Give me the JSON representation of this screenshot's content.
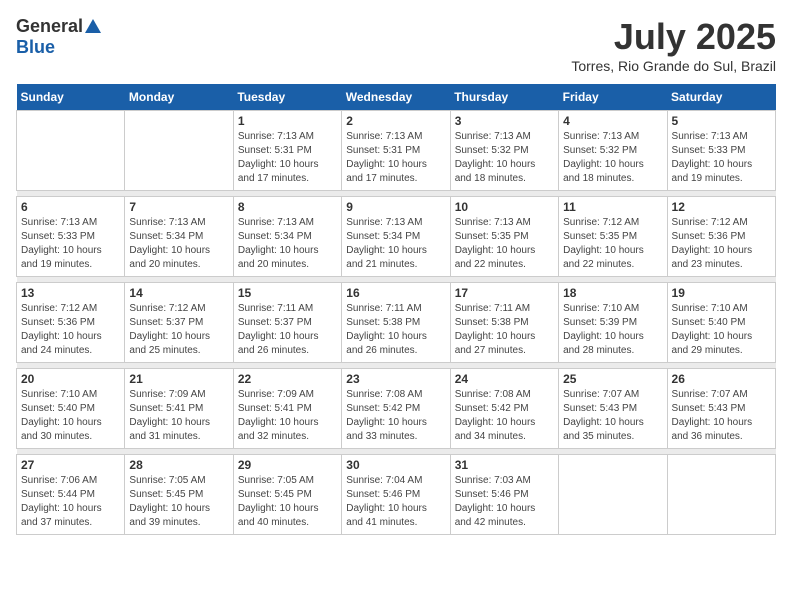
{
  "header": {
    "logo_general": "General",
    "logo_blue": "Blue",
    "month_title": "July 2025",
    "location": "Torres, Rio Grande do Sul, Brazil"
  },
  "calendar": {
    "days_of_week": [
      "Sunday",
      "Monday",
      "Tuesday",
      "Wednesday",
      "Thursday",
      "Friday",
      "Saturday"
    ],
    "weeks": [
      [
        {
          "day": "",
          "info": ""
        },
        {
          "day": "",
          "info": ""
        },
        {
          "day": "1",
          "info": "Sunrise: 7:13 AM\nSunset: 5:31 PM\nDaylight: 10 hours and 17 minutes."
        },
        {
          "day": "2",
          "info": "Sunrise: 7:13 AM\nSunset: 5:31 PM\nDaylight: 10 hours and 17 minutes."
        },
        {
          "day": "3",
          "info": "Sunrise: 7:13 AM\nSunset: 5:32 PM\nDaylight: 10 hours and 18 minutes."
        },
        {
          "day": "4",
          "info": "Sunrise: 7:13 AM\nSunset: 5:32 PM\nDaylight: 10 hours and 18 minutes."
        },
        {
          "day": "5",
          "info": "Sunrise: 7:13 AM\nSunset: 5:33 PM\nDaylight: 10 hours and 19 minutes."
        }
      ],
      [
        {
          "day": "6",
          "info": "Sunrise: 7:13 AM\nSunset: 5:33 PM\nDaylight: 10 hours and 19 minutes."
        },
        {
          "day": "7",
          "info": "Sunrise: 7:13 AM\nSunset: 5:34 PM\nDaylight: 10 hours and 20 minutes."
        },
        {
          "day": "8",
          "info": "Sunrise: 7:13 AM\nSunset: 5:34 PM\nDaylight: 10 hours and 20 minutes."
        },
        {
          "day": "9",
          "info": "Sunrise: 7:13 AM\nSunset: 5:34 PM\nDaylight: 10 hours and 21 minutes."
        },
        {
          "day": "10",
          "info": "Sunrise: 7:13 AM\nSunset: 5:35 PM\nDaylight: 10 hours and 22 minutes."
        },
        {
          "day": "11",
          "info": "Sunrise: 7:12 AM\nSunset: 5:35 PM\nDaylight: 10 hours and 22 minutes."
        },
        {
          "day": "12",
          "info": "Sunrise: 7:12 AM\nSunset: 5:36 PM\nDaylight: 10 hours and 23 minutes."
        }
      ],
      [
        {
          "day": "13",
          "info": "Sunrise: 7:12 AM\nSunset: 5:36 PM\nDaylight: 10 hours and 24 minutes."
        },
        {
          "day": "14",
          "info": "Sunrise: 7:12 AM\nSunset: 5:37 PM\nDaylight: 10 hours and 25 minutes."
        },
        {
          "day": "15",
          "info": "Sunrise: 7:11 AM\nSunset: 5:37 PM\nDaylight: 10 hours and 26 minutes."
        },
        {
          "day": "16",
          "info": "Sunrise: 7:11 AM\nSunset: 5:38 PM\nDaylight: 10 hours and 26 minutes."
        },
        {
          "day": "17",
          "info": "Sunrise: 7:11 AM\nSunset: 5:38 PM\nDaylight: 10 hours and 27 minutes."
        },
        {
          "day": "18",
          "info": "Sunrise: 7:10 AM\nSunset: 5:39 PM\nDaylight: 10 hours and 28 minutes."
        },
        {
          "day": "19",
          "info": "Sunrise: 7:10 AM\nSunset: 5:40 PM\nDaylight: 10 hours and 29 minutes."
        }
      ],
      [
        {
          "day": "20",
          "info": "Sunrise: 7:10 AM\nSunset: 5:40 PM\nDaylight: 10 hours and 30 minutes."
        },
        {
          "day": "21",
          "info": "Sunrise: 7:09 AM\nSunset: 5:41 PM\nDaylight: 10 hours and 31 minutes."
        },
        {
          "day": "22",
          "info": "Sunrise: 7:09 AM\nSunset: 5:41 PM\nDaylight: 10 hours and 32 minutes."
        },
        {
          "day": "23",
          "info": "Sunrise: 7:08 AM\nSunset: 5:42 PM\nDaylight: 10 hours and 33 minutes."
        },
        {
          "day": "24",
          "info": "Sunrise: 7:08 AM\nSunset: 5:42 PM\nDaylight: 10 hours and 34 minutes."
        },
        {
          "day": "25",
          "info": "Sunrise: 7:07 AM\nSunset: 5:43 PM\nDaylight: 10 hours and 35 minutes."
        },
        {
          "day": "26",
          "info": "Sunrise: 7:07 AM\nSunset: 5:43 PM\nDaylight: 10 hours and 36 minutes."
        }
      ],
      [
        {
          "day": "27",
          "info": "Sunrise: 7:06 AM\nSunset: 5:44 PM\nDaylight: 10 hours and 37 minutes."
        },
        {
          "day": "28",
          "info": "Sunrise: 7:05 AM\nSunset: 5:45 PM\nDaylight: 10 hours and 39 minutes."
        },
        {
          "day": "29",
          "info": "Sunrise: 7:05 AM\nSunset: 5:45 PM\nDaylight: 10 hours and 40 minutes."
        },
        {
          "day": "30",
          "info": "Sunrise: 7:04 AM\nSunset: 5:46 PM\nDaylight: 10 hours and 41 minutes."
        },
        {
          "day": "31",
          "info": "Sunrise: 7:03 AM\nSunset: 5:46 PM\nDaylight: 10 hours and 42 minutes."
        },
        {
          "day": "",
          "info": ""
        },
        {
          "day": "",
          "info": ""
        }
      ]
    ]
  }
}
